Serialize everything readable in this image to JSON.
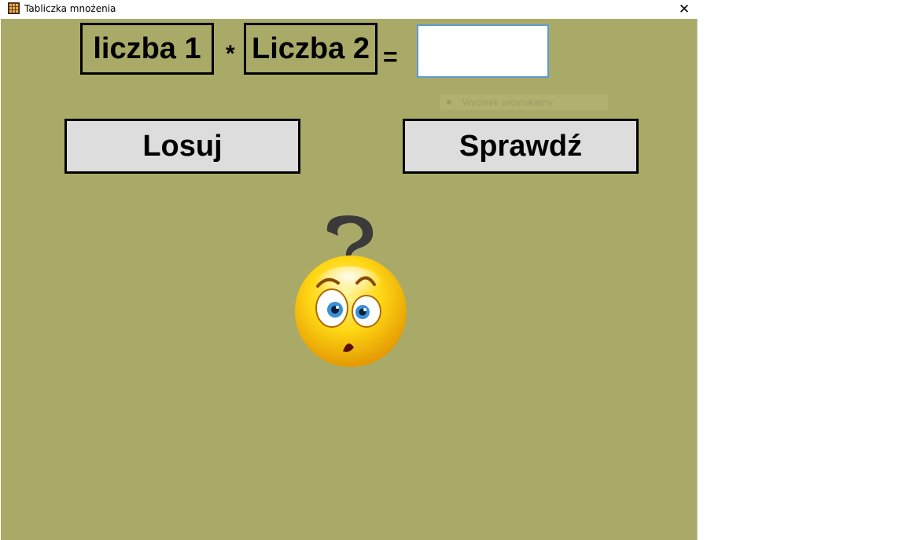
{
  "window": {
    "title": "Tabliczka mnożenia",
    "close_symbol": "✕"
  },
  "equation": {
    "number1": "liczba 1",
    "operator": "*",
    "number2": "Liczba 2",
    "equals": "=",
    "answer_value": ""
  },
  "hidden_control": {
    "label": "Wycinek prostokatny"
  },
  "buttons": {
    "draw": "Losuj",
    "check": "Sprawdź"
  },
  "image": {
    "icon": "confused-emoji-icon"
  },
  "colors": {
    "background": "#aaaa68",
    "button_bg": "#dddddd",
    "input_focus_border": "#5b9bd5"
  }
}
